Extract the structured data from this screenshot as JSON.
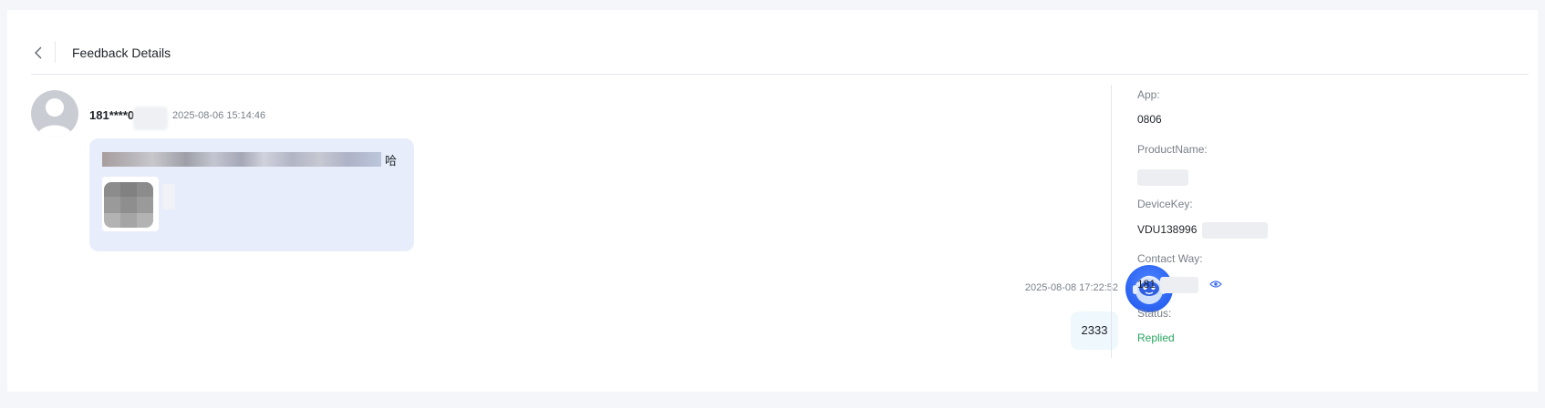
{
  "header": {
    "back_icon": "chevron-left-icon",
    "title": "Feedback Details"
  },
  "conversation": {
    "user_message": {
      "sender": "181****0",
      "time": "2025-08-06 15:14:46",
      "text_tail": "哈",
      "has_image": true
    },
    "agent_message": {
      "time": "2025-08-08 17:22:52",
      "text": "2333",
      "avatar_icon": "robot-avatar-icon"
    }
  },
  "details": {
    "app_label": "App:",
    "app_value": "0806",
    "product_label": "ProductName:",
    "device_label": "DeviceKey:",
    "device_value": "VDU138996",
    "contact_label": "Contact Way:",
    "contact_value": "181",
    "contact_icon": "eye-icon",
    "status_label": "Status:",
    "status_value": "Replied"
  },
  "colors": {
    "user_bubble": "#e8edfb",
    "agent_bubble": "#eef8fd",
    "agent_avatar": "#2a62f2",
    "status_replied": "#27a561",
    "accent": "#3b6cf0"
  }
}
